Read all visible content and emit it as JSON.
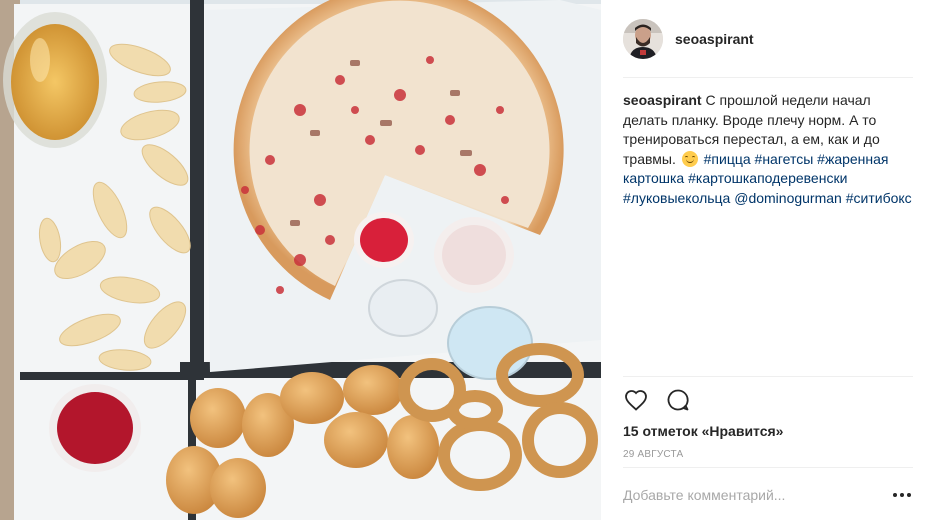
{
  "post": {
    "photo_alt": "Pizza, potato wedges, nuggets and onion rings in a box with a glass of beer",
    "author": {
      "username": "seoaspirant",
      "avatar_icon": "avatar-photo"
    },
    "caption": {
      "username": "seoaspirant",
      "text": "С прошлой недели начал делать планку. Вроде плечу норм. А то тренироваться перестал, а ем, как и до травмы.",
      "emoji": "smiling-face-emoji",
      "hashtags": [
        "#пицца",
        "#нагетсы",
        "#жаренная​картошка",
        "#картошкаподеревенски",
        "#луковыекольца"
      ],
      "mentions": [
        "@dominogurman",
        "#ситибокс"
      ]
    },
    "actions": {
      "like_icon": "heart-icon",
      "comment_icon": "comment-icon"
    },
    "likes_text": "15 отметок «Нравится»",
    "date": "29 августа",
    "comment_placeholder": "Добавьте комментарий...",
    "more_icon": "more-options-icon"
  },
  "colors": {
    "link": "#003569",
    "text": "#262626",
    "muted": "#999999"
  }
}
